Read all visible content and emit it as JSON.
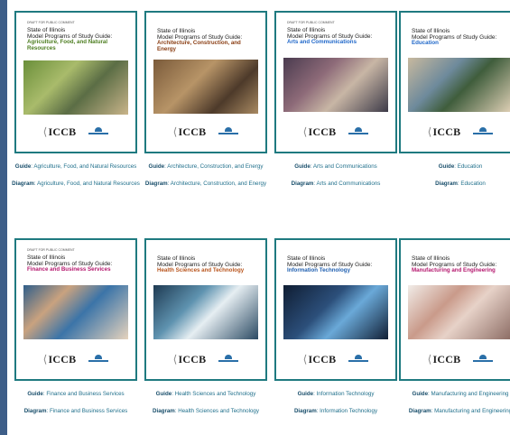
{
  "colors": {
    "frame": "#1f7a80",
    "link": "#1f6f8b",
    "backdrop": "#3e5e88"
  },
  "common": {
    "state": "State of Illinois",
    "guide_title": "Model Programs of Study Guide:",
    "draft_label": "DRAFT FOR PUBLIC COMMENT",
    "iccb_logo": "ICCB",
    "guide_prefix": "Guide",
    "diagram_prefix": "Diagram"
  },
  "cards": [
    {
      "cluster": "Agriculture, Food, and Natural Resources",
      "cluster_color": "#4c7d1f",
      "photo": "agriculture-photo",
      "draft": true
    },
    {
      "cluster": "Architecture, Construction, and Energy",
      "cluster_color": "#8a3d12",
      "photo": "construction-photo",
      "draft": false
    },
    {
      "cluster": "Arts and Communications",
      "cluster_color": "#1f67c9",
      "photo": "arts-photo",
      "draft": true
    },
    {
      "cluster": "Education",
      "cluster_color": "#1f67c9",
      "photo": "education-photo",
      "draft": false
    },
    {
      "cluster": "Finance and Business Services",
      "cluster_color": "#b5186e",
      "photo": "finance-photo",
      "draft": true
    },
    {
      "cluster": "Health Sciences and Technology",
      "cluster_color": "#b8541c",
      "photo": "health-photo",
      "draft": false
    },
    {
      "cluster": "Information Technology",
      "cluster_color": "#1f5fb0",
      "photo": "it-photo",
      "draft": false
    },
    {
      "cluster": "Manufacturing and Engineering",
      "cluster_color": "#b5186e",
      "photo": "manufacturing-photo",
      "draft": false
    }
  ]
}
